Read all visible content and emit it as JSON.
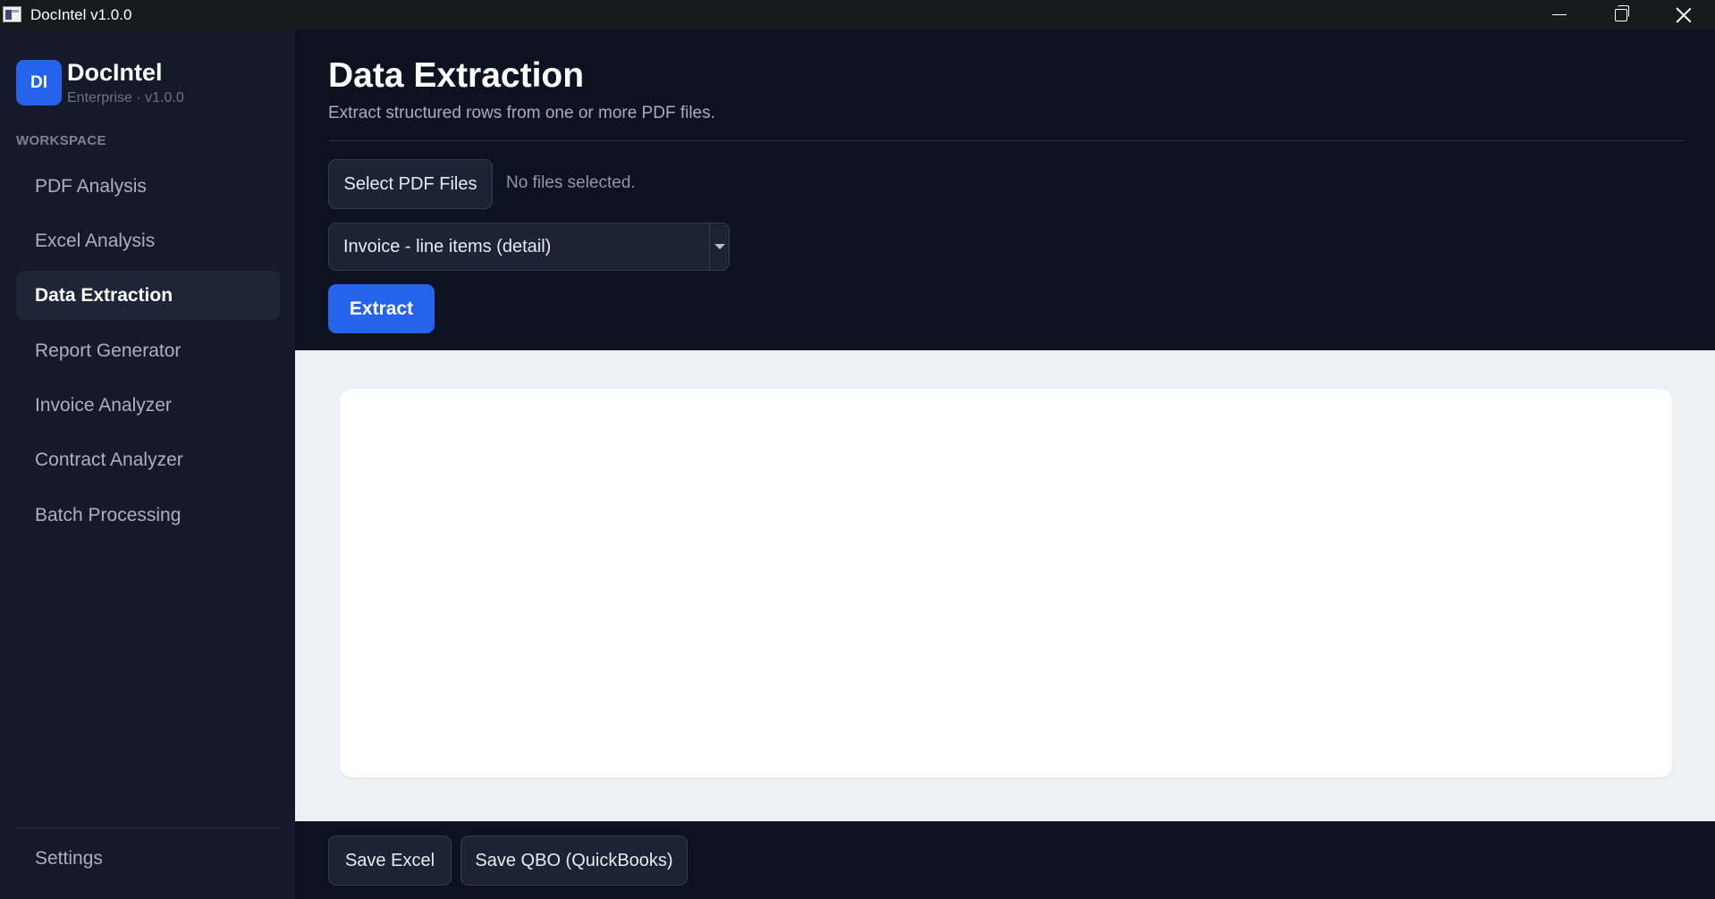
{
  "window": {
    "title": "DocIntel v1.0.0"
  },
  "sidebar": {
    "logo_initials": "DI",
    "brand_name": "DocIntel",
    "brand_sub": "Enterprise · v1.0.0",
    "section_label": "WORKSPACE",
    "items": [
      {
        "label": "PDF Analysis",
        "active": false
      },
      {
        "label": "Excel Analysis",
        "active": false
      },
      {
        "label": "Data Extraction",
        "active": true
      },
      {
        "label": "Report Generator",
        "active": false
      },
      {
        "label": "Invoice Analyzer",
        "active": false
      },
      {
        "label": "Contract Analyzer",
        "active": false
      },
      {
        "label": "Batch Processing",
        "active": false
      }
    ],
    "settings_label": "Settings"
  },
  "main": {
    "title": "Data Extraction",
    "subtitle": "Extract structured rows from one or more PDF files.",
    "select_files_label": "Select PDF Files",
    "files_status": "No files selected.",
    "template_select": {
      "selected": "Invoice - line items (detail)"
    },
    "extract_label": "Extract"
  },
  "footer": {
    "save_excel_label": "Save Excel",
    "save_qbo_label": "Save QBO (QuickBooks)"
  },
  "colors": {
    "accent": "#2563eb",
    "sidebar_bg": "#141a29",
    "main_bg": "#0c1220",
    "results_bg": "#edf0f5"
  }
}
